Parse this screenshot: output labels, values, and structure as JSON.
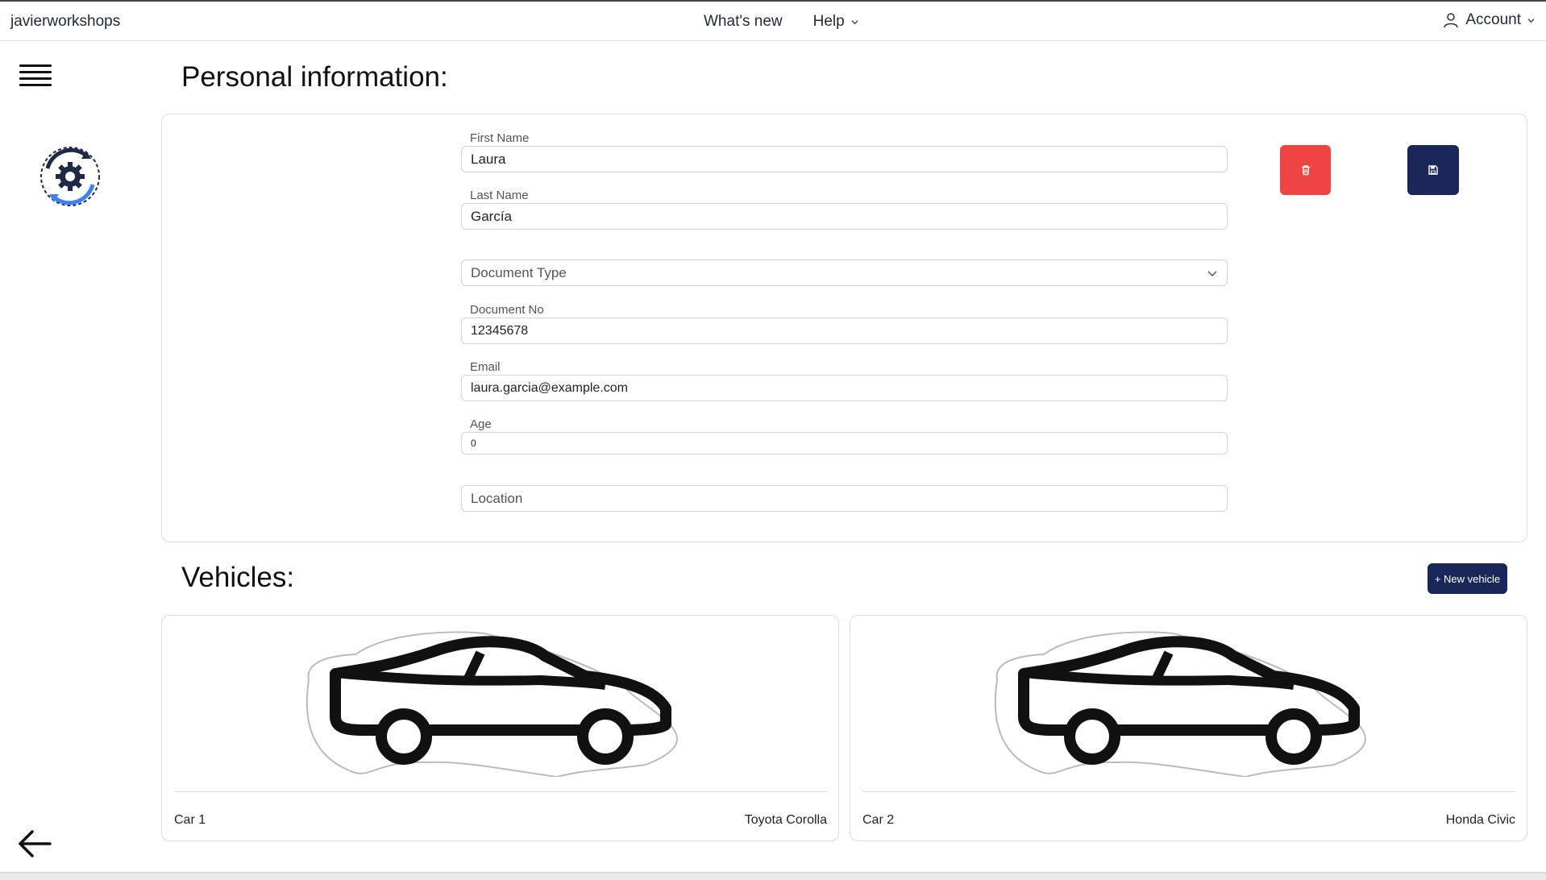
{
  "navbar": {
    "brand": "javierworkshops",
    "items": [
      {
        "label": "What's new",
        "has_dropdown": false
      },
      {
        "label": "Help",
        "has_dropdown": true
      }
    ],
    "account_label": "Account"
  },
  "sidebar": {
    "menu_icon": "hamburger-icon",
    "logo_icon": "gear-refresh-logo",
    "back_icon": "arrow-left-icon"
  },
  "personal_info": {
    "title": "Personal information:",
    "fields": {
      "first_name": {
        "label": "First Name",
        "value": "Laura"
      },
      "last_name": {
        "label": "Last Name",
        "value": "García"
      },
      "document_type": {
        "placeholder": "Document Type"
      },
      "document_no": {
        "label": "Document No",
        "value": "12345678"
      },
      "email": {
        "label": "Email",
        "value": "laura.garcia@example.com"
      },
      "age": {
        "label": "Age",
        "value": "0"
      },
      "location": {
        "placeholder": "Location"
      }
    },
    "actions": {
      "delete_icon": "trash-icon",
      "save_icon": "floppy-disk-icon"
    }
  },
  "vehicles": {
    "title": "Vehicles:",
    "new_button": "+ New vehicle",
    "items": [
      {
        "name": "Car 1",
        "model": "Toyota Corolla"
      },
      {
        "name": "Car 2",
        "model": "Honda Civic"
      }
    ]
  },
  "colors": {
    "navy": "#1b2759",
    "red": "#ef4444"
  }
}
